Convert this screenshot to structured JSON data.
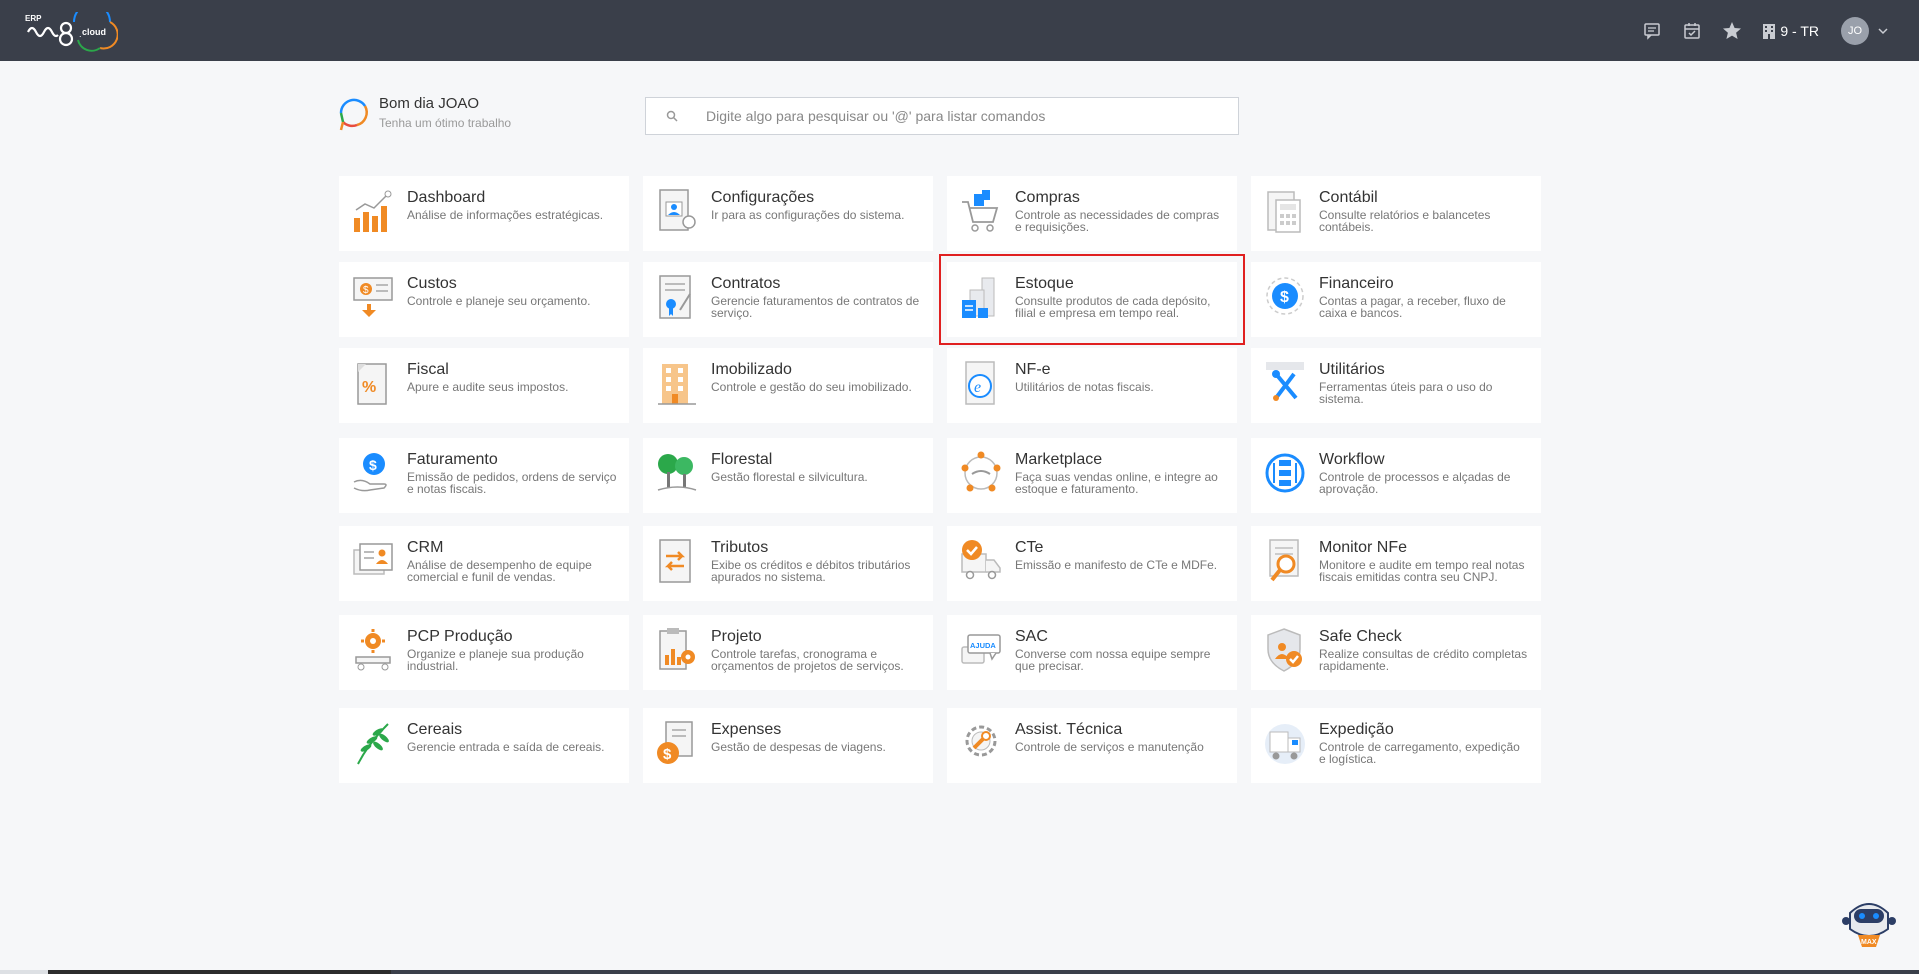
{
  "topbar": {
    "logo_small": "ERP",
    "logo_sub": "cloud",
    "company": "9 - TR",
    "avatar": "JO",
    "icons": [
      "chat-icon",
      "calendar-icon",
      "star-icon",
      "building-icon"
    ]
  },
  "greeting": {
    "title": "Bom dia JOAO",
    "subtitle": "Tenha um ótimo trabalho"
  },
  "search": {
    "placeholder": "Digite algo para pesquisar ou '@' para listar comandos",
    "value": ""
  },
  "modules": [
    {
      "title": "Dashboard",
      "desc": "Análise de informações estratégicas."
    },
    {
      "title": "Configurações",
      "desc": "Ir para as configurações do sistema."
    },
    {
      "title": "Compras",
      "desc": "Controle as necessidades de compras e requisições."
    },
    {
      "title": "Contábil",
      "desc": "Consulte relatórios e balancetes contábeis."
    },
    {
      "title": "Custos",
      "desc": "Controle e planeje seu orçamento."
    },
    {
      "title": "Contratos",
      "desc": "Gerencie faturamentos de contratos de serviço."
    },
    {
      "title": "Estoque",
      "desc": "Consulte produtos de cada depósito, filial e empresa em tempo real."
    },
    {
      "title": "Financeiro",
      "desc": "Contas a pagar, a receber, fluxo de caixa e bancos."
    },
    {
      "title": "Fiscal",
      "desc": "Apure e audite seus impostos."
    },
    {
      "title": "Imobilizado",
      "desc": "Controle e gestão do seu imobilizado."
    },
    {
      "title": "NF-e",
      "desc": "Utilitários de notas fiscais."
    },
    {
      "title": "Utilitários",
      "desc": "Ferramentas úteis para o uso do sistema."
    },
    {
      "title": "Faturamento",
      "desc": "Emissão de pedidos, ordens de serviço e notas fiscais."
    },
    {
      "title": "Florestal",
      "desc": "Gestão florestal e silvicultura."
    },
    {
      "title": "Marketplace",
      "desc": "Faça suas vendas online, e integre ao estoque e faturamento."
    },
    {
      "title": "Workflow",
      "desc": "Controle de processos e alçadas de aprovação."
    },
    {
      "title": "CRM",
      "desc": "Análise de desempenho de equipe comercial e funil de vendas."
    },
    {
      "title": "Tributos",
      "desc": "Exibe os créditos e débitos tributários apurados no sistema."
    },
    {
      "title": "CTe",
      "desc": "Emissão e manifesto de CTe e MDFe."
    },
    {
      "title": "Monitor NFe",
      "desc": "Monitore e audite em tempo real notas fiscais emitidas contra seu CNPJ."
    },
    {
      "title": "PCP Produção",
      "desc": "Organize e planeje sua produção industrial."
    },
    {
      "title": "Projeto",
      "desc": "Controle tarefas, cronograma e orçamentos de projetos de serviços."
    },
    {
      "title": "SAC",
      "desc": "Converse com nossa equipe sempre que precisar."
    },
    {
      "title": "Safe Check",
      "desc": "Realize consultas de crédito completas rapidamente."
    },
    {
      "title": "Cereais",
      "desc": "Gerencie entrada e saída de cereais."
    },
    {
      "title": "Expenses",
      "desc": "Gestão de despesas de viagens."
    },
    {
      "title": "Assist. Técnica",
      "desc": "Controle de serviços e manutenção"
    },
    {
      "title": "Expedição",
      "desc": "Controle de carregamento, expedição e logística."
    }
  ],
  "sac_badge": "AJUDA",
  "robot_label": "MAX",
  "colors": {
    "topbar": "#3a3f4a",
    "accent_orange": "#f08a24",
    "accent_blue": "#1a8cff",
    "highlight": "#e02020"
  }
}
